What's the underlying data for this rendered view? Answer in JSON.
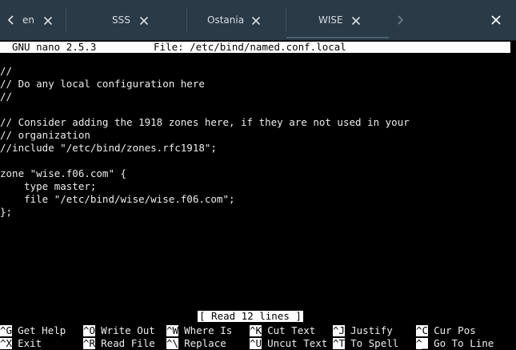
{
  "tabs": [
    {
      "label": "en",
      "close_icon": "close-icon"
    },
    {
      "label": "SSS",
      "close_icon": "close-icon"
    },
    {
      "label": "Ostania",
      "close_icon": "close-icon"
    },
    {
      "label": "WISE",
      "close_icon": "close-icon",
      "active": true
    }
  ],
  "nav": {
    "prev_icon": "chevron-left-icon",
    "next_icon": "chevron-right-icon"
  },
  "window": {
    "close_icon": "close-icon"
  },
  "nano": {
    "version": "GNU nano 2.5.3",
    "file": "File: /etc/bind/named.conf.local"
  },
  "editor_lines": [
    "//",
    "// Do any local configuration here",
    "//",
    "",
    "// Consider adding the 1918 zones here, if they are not used in your",
    "// organization",
    "//include \"/etc/bind/zones.rfc1918\";",
    "",
    "zone \"wise.f06.com\" {",
    "    type master;",
    "    file \"/etc/bind/wise/wise.f06.com\";",
    "};"
  ],
  "status": "[ Read 12 lines ]",
  "shortcuts_row1": [
    {
      "key": "^G",
      "label": "Get Help"
    },
    {
      "key": "^O",
      "label": "Write Out"
    },
    {
      "key": "^W",
      "label": "Where Is"
    },
    {
      "key": "^K",
      "label": "Cut Text"
    },
    {
      "key": "^J",
      "label": "Justify"
    },
    {
      "key": "^C",
      "label": "Cur Pos"
    }
  ],
  "shortcuts_row2": [
    {
      "key": "^X",
      "label": "Exit"
    },
    {
      "key": "^R",
      "label": "Read File"
    },
    {
      "key": "^\\",
      "label": "Replace"
    },
    {
      "key": "^U",
      "label": "Uncut Text"
    },
    {
      "key": "^T",
      "label": "To Spell"
    },
    {
      "key": "^_",
      "label": "Go To Line"
    }
  ],
  "colors": {
    "tabbar_bg": "#2a3a46",
    "terminal_bg": "#000000",
    "terminal_fg": "#ededed",
    "inverse_bg": "#ffffff"
  }
}
